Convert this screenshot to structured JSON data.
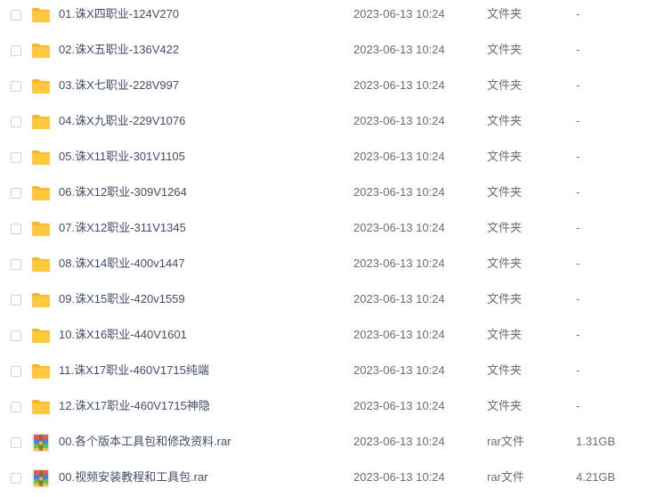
{
  "rows": [
    {
      "name": "01.诛X四职业-124V270",
      "date": "2023-06-13 10:24",
      "type": "文件夹",
      "size": "-",
      "icon": "folder-icon"
    },
    {
      "name": "02.诛X五职业-136V422",
      "date": "2023-06-13 10:24",
      "type": "文件夹",
      "size": "-",
      "icon": "folder-icon"
    },
    {
      "name": "03.诛X七职业-228V997",
      "date": "2023-06-13 10:24",
      "type": "文件夹",
      "size": "-",
      "icon": "folder-icon"
    },
    {
      "name": "04.诛X九职业-229V1076",
      "date": "2023-06-13 10:24",
      "type": "文件夹",
      "size": "-",
      "icon": "folder-icon"
    },
    {
      "name": "05.诛X11职业-301V1105",
      "date": "2023-06-13 10:24",
      "type": "文件夹",
      "size": "-",
      "icon": "folder-icon"
    },
    {
      "name": "06.诛X12职业-309V1264",
      "date": "2023-06-13 10:24",
      "type": "文件夹",
      "size": "-",
      "icon": "folder-icon"
    },
    {
      "name": "07.诛X12职业-311V1345",
      "date": "2023-06-13 10:24",
      "type": "文件夹",
      "size": "-",
      "icon": "folder-icon"
    },
    {
      "name": "08.诛X14职业-400v1447",
      "date": "2023-06-13 10:24",
      "type": "文件夹",
      "size": "-",
      "icon": "folder-icon"
    },
    {
      "name": "09.诛X15职业-420v1559",
      "date": "2023-06-13 10:24",
      "type": "文件夹",
      "size": "-",
      "icon": "folder-icon"
    },
    {
      "name": "10.诛X16职业-440V1601",
      "date": "2023-06-13 10:24",
      "type": "文件夹",
      "size": "-",
      "icon": "folder-icon"
    },
    {
      "name": "11.诛X17职业-460V1715纯端",
      "date": "2023-06-13 10:24",
      "type": "文件夹",
      "size": "-",
      "icon": "folder-icon"
    },
    {
      "name": "12.诛X17职业-460V1715神隐",
      "date": "2023-06-13 10:24",
      "type": "文件夹",
      "size": "-",
      "icon": "folder-icon"
    },
    {
      "name": "00.各个版本工具包和修改资料.rar",
      "date": "2023-06-13 10:24",
      "type": "rar文件",
      "size": "1.31GB",
      "icon": "rar-archive-icon"
    },
    {
      "name": "00.视频安装教程和工具包.rar",
      "date": "2023-06-13 10:24",
      "type": "rar文件",
      "size": "4.21GB",
      "icon": "rar-archive-icon"
    }
  ],
  "colors": {
    "folder": "#ffc83d",
    "folder_tab": "#f5b623",
    "rar_blue": "#4a7fe0",
    "rar_green": "#5cc15c",
    "rar_red": "#e85b4a",
    "rar_yellow": "#f4c430"
  }
}
